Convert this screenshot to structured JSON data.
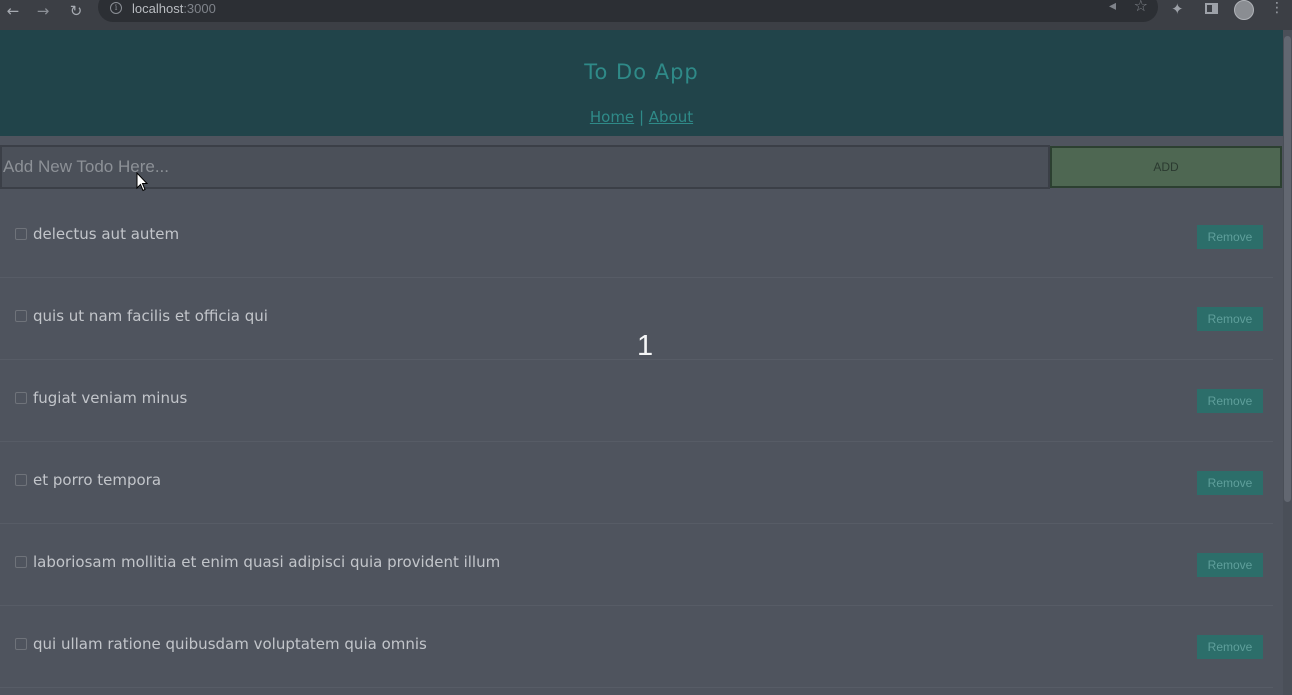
{
  "browser": {
    "url_host": "localhost",
    "url_port": ":3000"
  },
  "app": {
    "title": "To Do App",
    "nav": {
      "home": "Home",
      "separator": "|",
      "about": "About"
    }
  },
  "add": {
    "placeholder": "Add New Todo Here...",
    "button_label": "ADD"
  },
  "todos": [
    {
      "text": "delectus aut autem",
      "remove_label": "Remove",
      "checked": false
    },
    {
      "text": "quis ut nam facilis et officia qui",
      "remove_label": "Remove",
      "checked": false
    },
    {
      "text": "fugiat veniam minus",
      "remove_label": "Remove",
      "checked": false
    },
    {
      "text": "et porro tempora",
      "remove_label": "Remove",
      "checked": false
    },
    {
      "text": "laboriosam mollitia et enim quasi adipisci quia provident illum",
      "remove_label": "Remove",
      "checked": false
    },
    {
      "text": "qui ullam ratione quibusdam voluptatem quia omnis",
      "remove_label": "Remove",
      "checked": false
    }
  ],
  "overlay": {
    "page_number": "1"
  },
  "colors": {
    "header_bg": "#21444a",
    "accent": "#2f8a88",
    "remove_bg": "#2c6e6a",
    "add_bg": "#4e6752",
    "page_bg": "#4f545e"
  }
}
